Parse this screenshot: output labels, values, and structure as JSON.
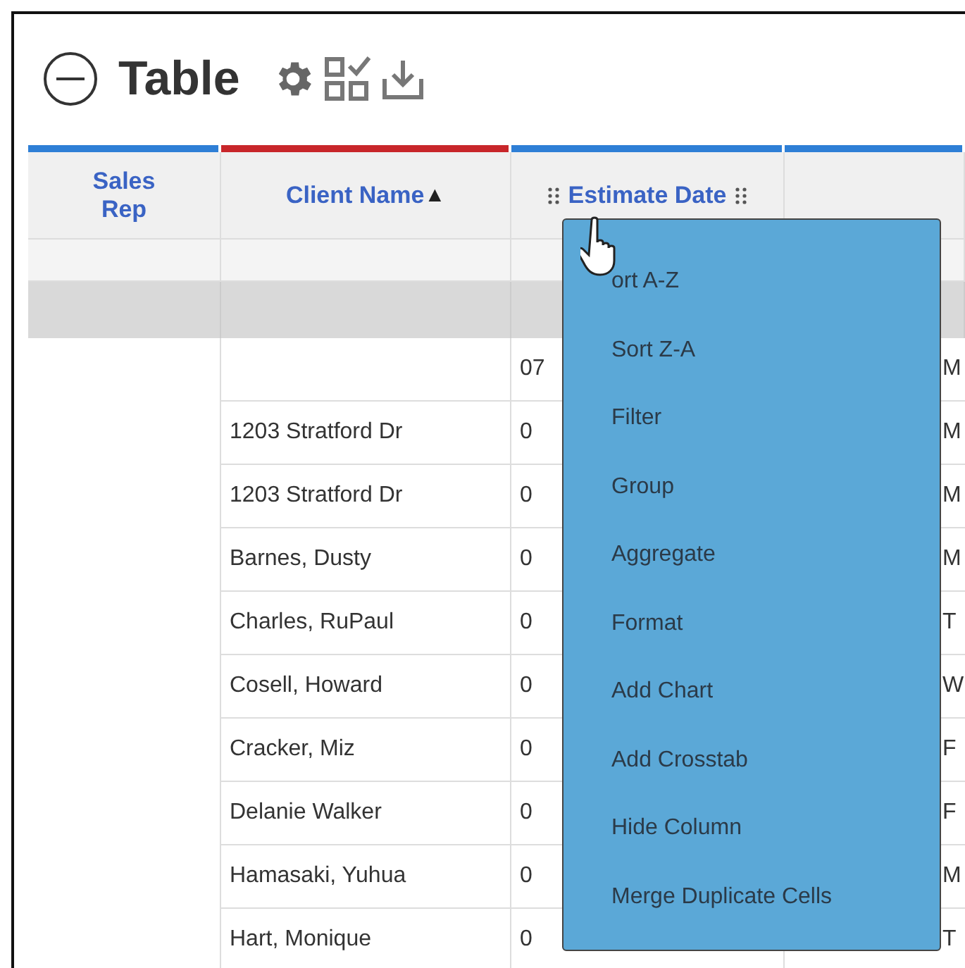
{
  "title": "Table",
  "columns": [
    {
      "label": "Sales Rep",
      "color": "#2e7fd6"
    },
    {
      "label": "Client Name",
      "color": "#c8262a",
      "sort_arrow": "▲"
    },
    {
      "label": "Estimate Date",
      "color": "#2e7fd6",
      "handles": true
    },
    {
      "color": "#2e7fd6"
    }
  ],
  "rows": [
    {
      "client": "",
      "date": "07",
      "day": "M"
    },
    {
      "client": "1203 Stratford Dr",
      "date": "0",
      "day": "M"
    },
    {
      "client": "1203 Stratford Dr",
      "date": "0",
      "day": "M"
    },
    {
      "client": "Barnes, Dusty",
      "date": "0",
      "day": "M"
    },
    {
      "client": "Charles, RuPaul",
      "date": "0",
      "day": "T"
    },
    {
      "client": "Cosell, Howard",
      "date": "0",
      "day": "W"
    },
    {
      "client": "Cracker, Miz",
      "date": "0",
      "day": "F"
    },
    {
      "client": "Delanie Walker",
      "date": "0",
      "day": "F"
    },
    {
      "client": "Hamasaki, Yuhua",
      "date": "0",
      "day": "M"
    },
    {
      "client": "Hart, Monique",
      "date": "0",
      "day": "T"
    }
  ],
  "menu": [
    "ort A-Z",
    "Sort Z-A",
    "Filter",
    "Group",
    "Aggregate",
    "Format",
    "Add Chart",
    "Add Crosstab",
    "Hide Column",
    "Merge Duplicate Cells"
  ]
}
